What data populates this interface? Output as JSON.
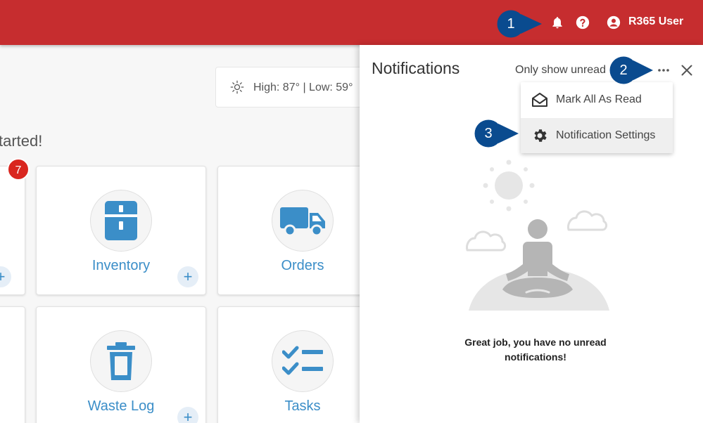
{
  "header": {
    "user_name": "R365 User",
    "icons": [
      "bell-icon",
      "help-icon",
      "account-icon"
    ],
    "bar_color": "#c62d2f"
  },
  "callouts": [
    "1",
    "2",
    "3"
  ],
  "dashboard": {
    "weather_text": "High: 87° | Low: 59°",
    "getting_started_text": "tarted!",
    "badge_count": "7",
    "cards": [
      {
        "label": "Inventory",
        "icon": "fridge-icon"
      },
      {
        "label": "Orders",
        "icon": "truck-icon"
      },
      {
        "label": "Waste Log",
        "icon": "trash-icon"
      },
      {
        "label": "Tasks",
        "icon": "checklist-icon"
      }
    ],
    "plus_label": "+",
    "accent_color": "#3b8ec8"
  },
  "notifications": {
    "title": "Notifications",
    "unread_filter_label": "Only show unread",
    "menu": [
      {
        "label": "Mark All As Read",
        "icon": "envelope-open-icon"
      },
      {
        "label": "Notification Settings",
        "icon": "gear-icon"
      }
    ],
    "empty_line1": "Great job, you have no unread",
    "empty_line2": "notifications!"
  }
}
